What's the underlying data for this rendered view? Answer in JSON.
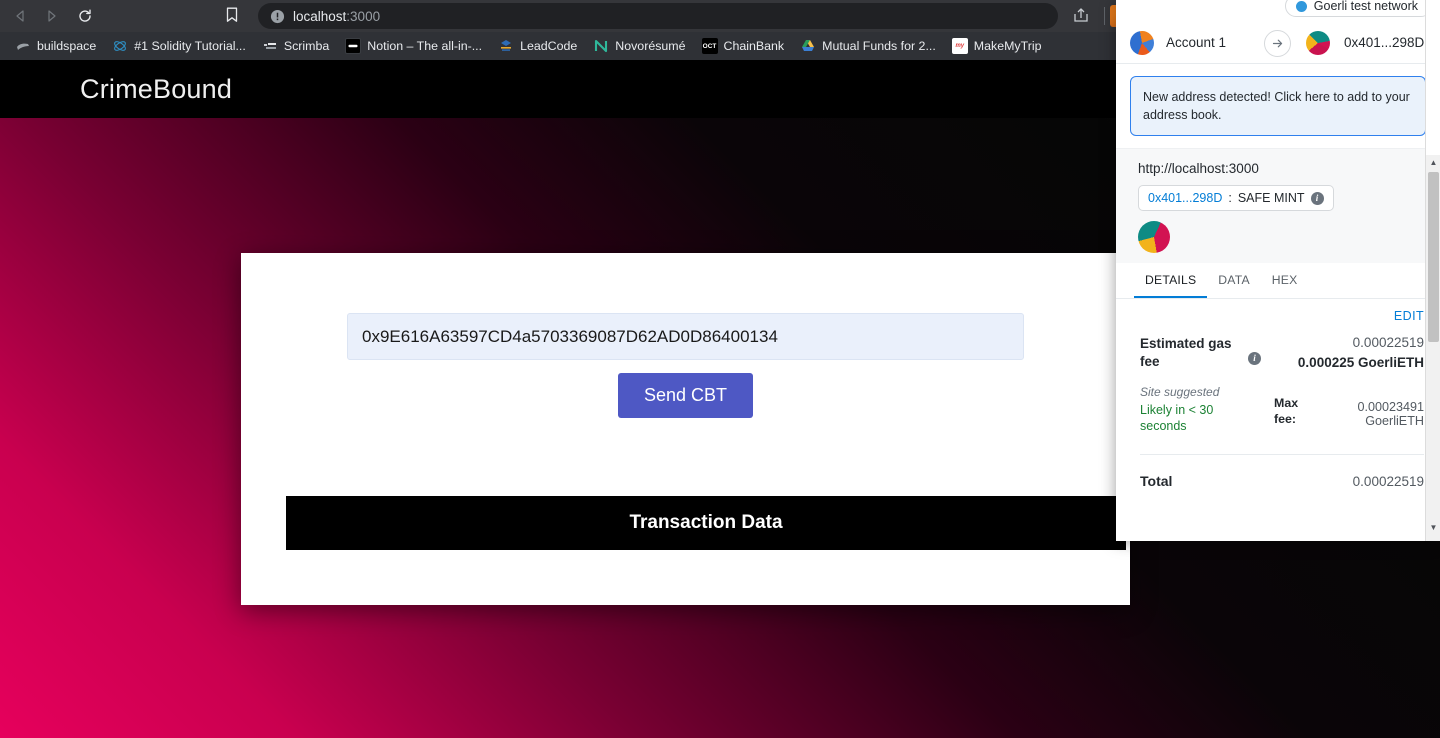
{
  "browser": {
    "nav": {
      "back": "back-arrow",
      "forward": "forward-arrow",
      "reload": "reload"
    },
    "omnibox": {
      "host": "localhost",
      "port": ":3000",
      "security_icon": "not-secure-info-icon"
    },
    "bookmarks": [
      {
        "label": "buildspace",
        "icon": "buildspace-hand"
      },
      {
        "label": "#1 Solidity Tutorial...",
        "icon": "solidity-atom"
      },
      {
        "label": "Scrimba",
        "icon": "scrimba-logo"
      },
      {
        "label": "Notion – The all-in-...",
        "icon": "notion-logo"
      },
      {
        "label": "LeadCode",
        "icon": "leadcode-logo"
      },
      {
        "label": "Novorésumé",
        "icon": "novoresume-n"
      },
      {
        "label": "ChainBank",
        "icon": "chainbank-oct"
      },
      {
        "label": "Mutual Funds for 2...",
        "icon": "google-drive"
      },
      {
        "label": "MakeMyTrip",
        "icon": "makemytrip-logo"
      }
    ]
  },
  "site": {
    "title": "CrimeBound",
    "address_value": "0x9E616A63597CD4a5703369087D62AD0D86400134",
    "address_placeholder": "0x...",
    "send_button": "Send CBT",
    "transaction_data_heading": "Transaction Data"
  },
  "metamask": {
    "network": {
      "label": "Goerli test network",
      "dot_color": "#3098dc"
    },
    "account": {
      "from_name": "Account 1",
      "to_address": "0x401...298D",
      "arrow": "arrow-right-icon"
    },
    "banner": "New address detected! Click here to add to your address book.",
    "origin": {
      "url": "http://localhost:3000",
      "contract": "0x401...298D",
      "separator": " : ",
      "method": "SAFE MINT",
      "info_icon": "info-icon"
    },
    "tabs": [
      {
        "label": "DETAILS",
        "active": true
      },
      {
        "label": "DATA",
        "active": false
      },
      {
        "label": "HEX",
        "active": false
      }
    ],
    "edit_label": "EDIT",
    "gas": {
      "label": "Estimated gas fee",
      "info_icon": "info-icon",
      "fiat": "0.00022519",
      "eth": "0.000225 GoerliETH",
      "site_suggested": "Site suggested",
      "likely_time": "Likely in < 30 seconds",
      "max_fee_label": "Max fee:",
      "max_fee_value": "0.00023491 GoerliETH"
    },
    "total": {
      "label": "Total",
      "fiat": "0.00022519"
    }
  }
}
